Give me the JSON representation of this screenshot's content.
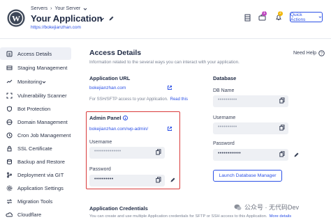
{
  "header": {
    "breadcrumb_root": "Servers",
    "breadcrumb_sep": "›",
    "breadcrumb_server": "Your Server",
    "app_title": "Your Application",
    "app_url": "https://bokejianzhan.com",
    "notif_badge_1": "1",
    "notif_badge_2": "2",
    "quick_actions": "Quick Actions"
  },
  "sidebar": {
    "items": [
      {
        "label": "Access Details",
        "icon": "access-icon"
      },
      {
        "label": "Staging Management",
        "icon": "staging-icon"
      },
      {
        "label": "Monitoring",
        "icon": "monitoring-icon"
      },
      {
        "label": "Vulnerability Scanner",
        "icon": "scanner-icon"
      },
      {
        "label": "Bot Protection",
        "icon": "bot-icon"
      },
      {
        "label": "Domain Management",
        "icon": "domain-icon"
      },
      {
        "label": "Cron Job Management",
        "icon": "cron-icon"
      },
      {
        "label": "SSL Certificate",
        "icon": "ssl-icon"
      },
      {
        "label": "Backup and Restore",
        "icon": "backup-icon"
      },
      {
        "label": "Deployment via GIT",
        "icon": "git-icon"
      },
      {
        "label": "Application Settings",
        "icon": "settings-icon"
      },
      {
        "label": "Migration Tools",
        "icon": "migration-icon"
      },
      {
        "label": "Cloudflare",
        "icon": "cloudflare-icon"
      }
    ]
  },
  "main": {
    "title": "Access Details",
    "help": "Need Help",
    "subtitle": "Information related to the several ways you can interact with your application.",
    "app_url_title": "Application URL",
    "app_url_value": "bokejianzhan.com",
    "sftp_note": "For SSH/SFTP access to your Application.",
    "read_this": "Read this",
    "admin_panel_title": "Admin Panel",
    "admin_url": "bokejianzhan.com/wp-admin/",
    "admin_username_label": "Username",
    "admin_username_value": "••••••••••••••",
    "admin_password_label": "Password",
    "admin_password_value": "••••••••••",
    "db_title": "Database",
    "db_name_label": "DB Name",
    "db_name_value": "••••••••••",
    "db_username_label": "Username",
    "db_username_value": "••••••••••",
    "db_password_label": "Password",
    "db_password_value": "••••••••••••",
    "launch_db": "Launch Database Manager",
    "credentials_title": "Application Credentials",
    "credentials_note": "You can create and use multiple Application credentials for SFTP or SSH access to this Application.",
    "more_details": "More details"
  },
  "watermark": "公众号 · 无代码Dev",
  "colors": {
    "accent": "#2b50e6",
    "highlight": "#d93a3a"
  }
}
